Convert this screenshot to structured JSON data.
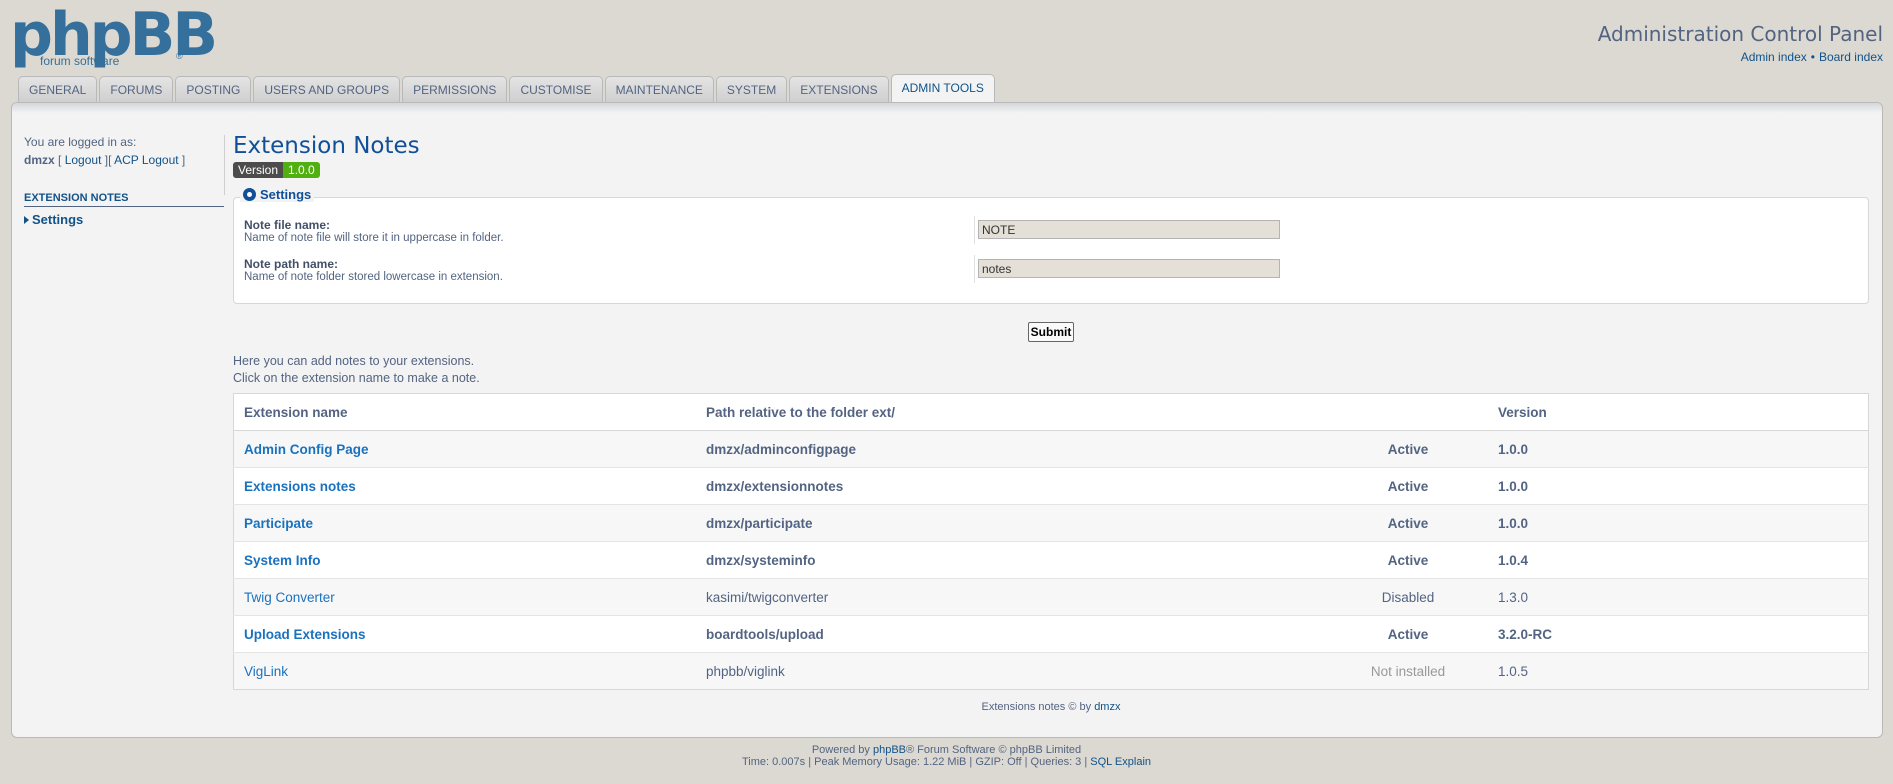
{
  "header": {
    "logo_text": "phpBB",
    "logo_subtext": "forum  software",
    "logo_reg": "®",
    "title": "Administration Control Panel",
    "links": [
      "Admin index",
      "Board index"
    ],
    "link_separator": "•"
  },
  "tabs": [
    {
      "label": "General",
      "active": false
    },
    {
      "label": "Forums",
      "active": false
    },
    {
      "label": "Posting",
      "active": false
    },
    {
      "label": "Users and Groups",
      "active": false
    },
    {
      "label": "Permissions",
      "active": false
    },
    {
      "label": "Customise",
      "active": false
    },
    {
      "label": "Maintenance",
      "active": false
    },
    {
      "label": "System",
      "active": false
    },
    {
      "label": "Extensions",
      "active": false
    },
    {
      "label": "Admin Tools",
      "active": true
    }
  ],
  "sidebar": {
    "logged_in_label": "You are logged in as:",
    "username": "dmzx",
    "logout_label": "Logout",
    "acp_logout_label": "ACP Logout",
    "section_heading": "Extension notes",
    "items": [
      {
        "label": "Settings"
      }
    ]
  },
  "main": {
    "title": "Extension Notes",
    "version_label": "Version",
    "version_value": "1.0.0",
    "settings_legend": "Settings",
    "fields": [
      {
        "label": "Note file name:",
        "description": "Name of note file will store it in uppercase in folder.",
        "value": "NOTE"
      },
      {
        "label": "Note path name:",
        "description": "Name of note folder stored lowercase in extension.",
        "value": "notes"
      }
    ],
    "submit_label": "Submit",
    "intro_line1": "Here you can add notes to your extensions.",
    "intro_line2": "Click on the extension name to make a note."
  },
  "table": {
    "headers": [
      "Extension name",
      "Path relative to the folder ext/",
      "",
      "Version"
    ],
    "rows": [
      {
        "name": "Admin Config Page",
        "path": "dmzx/adminconfigpage",
        "status": "Active",
        "version": "1.0.0"
      },
      {
        "name": "Extensions notes",
        "path": "dmzx/extensionnotes",
        "status": "Active",
        "version": "1.0.0"
      },
      {
        "name": "Participate",
        "path": "dmzx/participate",
        "status": "Active",
        "version": "1.0.0"
      },
      {
        "name": "System Info",
        "path": "dmzx/systeminfo",
        "status": "Active",
        "version": "1.0.4"
      },
      {
        "name": "Twig Converter",
        "path": "kasimi/twigconverter",
        "status": "Disabled",
        "version": "1.3.0"
      },
      {
        "name": "Upload Extensions",
        "path": "boardtools/upload",
        "status": "Active",
        "version": "3.2.0-RC"
      },
      {
        "name": "VigLink",
        "path": "phpbb/viglink",
        "status": "Not installed",
        "version": "1.0.5"
      }
    ]
  },
  "ext_footer": {
    "text": "Extensions notes © by ",
    "author": "dmzx"
  },
  "footer": {
    "powered_prefix": "Powered by ",
    "powered_link": "phpBB",
    "powered_suffix": "® Forum Software © phpBB Limited",
    "stats": "Time: 0.007s | Peak Memory Usage: 1.22 MiB | GZIP: Off | Queries: 3 | ",
    "sql_explain": "SQL Explain"
  },
  "colors": {
    "background": "#dcd9d2",
    "panel": "#f3f3f3",
    "link": "#105289",
    "title": "#115098",
    "text": "#536482",
    "version_badge": "#4fb00f"
  }
}
